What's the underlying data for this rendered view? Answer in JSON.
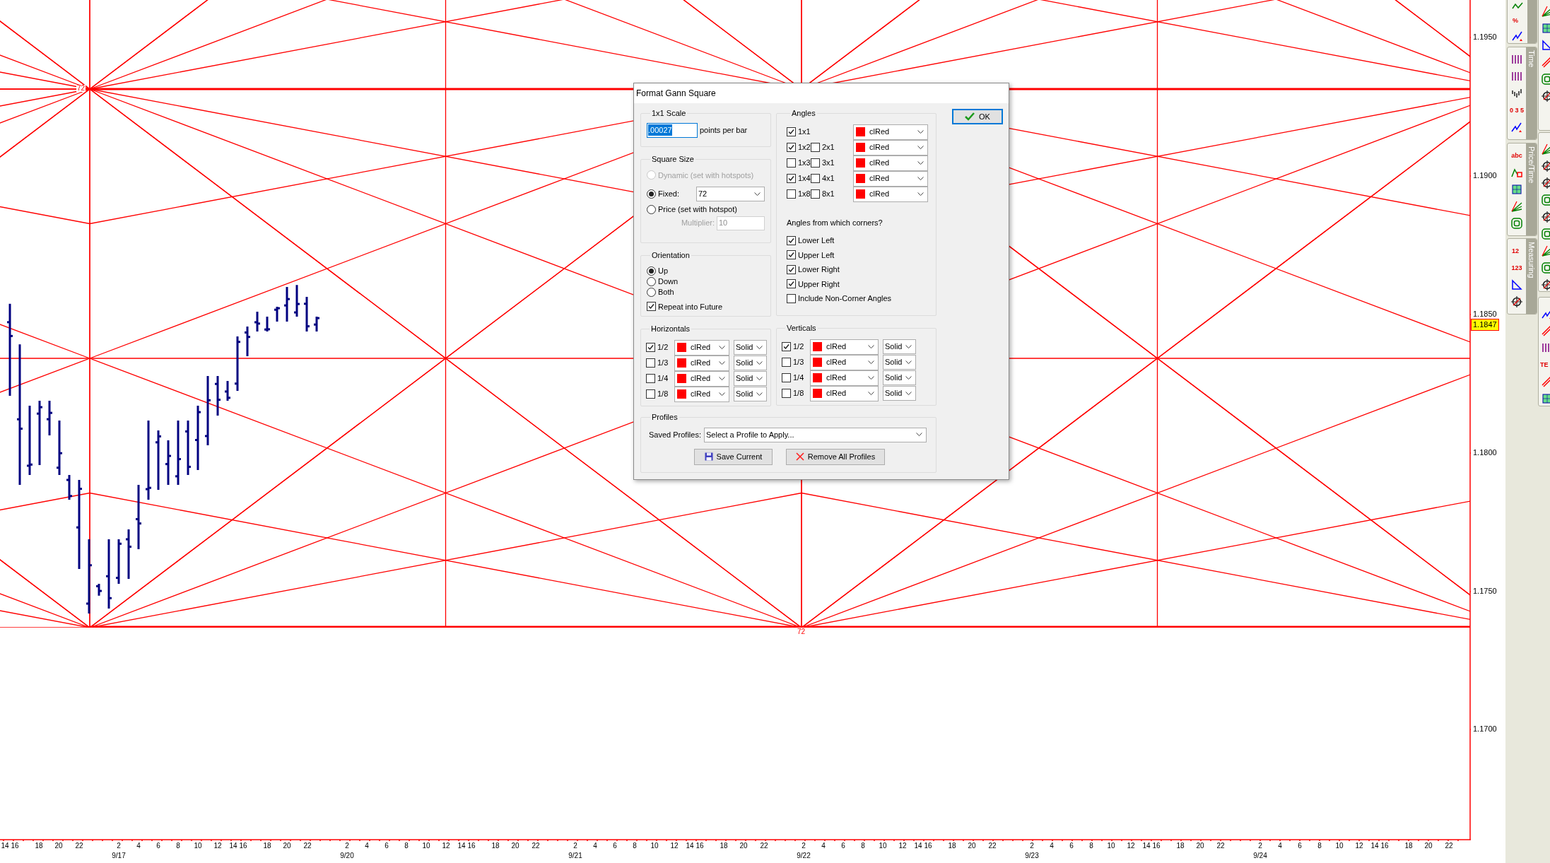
{
  "chart": {
    "price_labels": [
      "1.1950",
      "1.1900",
      "1.1850",
      "1.1800",
      "1.1750",
      "1.1700"
    ],
    "current_price": "1.1847",
    "square_labels": [
      "72",
      "72"
    ],
    "time_axis": [
      {
        "hours": [
          "14 16",
          "18",
          "20",
          "22"
        ]
      },
      {
        "date": "9/17",
        "hours": [
          "2",
          "4",
          "6",
          "8",
          "10",
          "12",
          "14 16",
          "18",
          "20",
          "22"
        ]
      },
      {
        "date": "9/20",
        "hours": [
          "2",
          "4",
          "6",
          "8",
          "10",
          "12",
          "14 16",
          "18",
          "20",
          "22"
        ]
      },
      {
        "date": "9/21",
        "hours": [
          "2",
          "4",
          "6",
          "8",
          "10",
          "12",
          "14 16",
          "18",
          "20",
          "22"
        ]
      },
      {
        "date": "9/22",
        "hours": [
          "2",
          "4",
          "6",
          "8",
          "10",
          "12",
          "14 16",
          "18",
          "20",
          "22"
        ]
      },
      {
        "date": "9/23",
        "hours": [
          "2",
          "4",
          "6",
          "8",
          "10",
          "12",
          "14 16",
          "18",
          "20",
          "22"
        ]
      },
      {
        "date": "9/24",
        "hours": [
          "2",
          "4",
          "6",
          "8",
          "10",
          "12",
          "14 16",
          "18",
          "20",
          "22"
        ]
      }
    ]
  },
  "toolbars": [
    {
      "buttons": [
        {
          "kind": "wave"
        },
        {
          "kind": "text",
          "label": "%"
        },
        {
          "kind": "trend"
        }
      ]
    },
    {
      "title": "Time",
      "buttons": [
        {
          "kind": "cycles"
        },
        {
          "kind": "cycles"
        },
        {
          "kind": "bars"
        },
        {
          "kind": "text",
          "label": "0 3 5"
        },
        {
          "kind": "trend"
        }
      ]
    },
    {
      "title": "Price/Time",
      "buttons": [
        {
          "kind": "text",
          "label": "abc"
        },
        {
          "kind": "zigzag"
        },
        {
          "kind": "grid"
        },
        {
          "kind": "fan"
        },
        {
          "kind": "spiral"
        }
      ]
    },
    {
      "title": "Measuring",
      "buttons": [
        {
          "kind": "text",
          "label": "12"
        },
        {
          "kind": "text",
          "label": "123"
        },
        {
          "kind": "triangle"
        },
        {
          "kind": "target"
        }
      ]
    }
  ],
  "side_toolbars": [
    {
      "buttons": [
        {
          "kind": "fan"
        },
        {
          "kind": "grid"
        },
        {
          "kind": "triangle"
        },
        {
          "kind": "lines"
        },
        {
          "kind": "spiral"
        },
        {
          "kind": "target"
        }
      ]
    },
    {
      "buttons": [
        {
          "kind": "fan"
        },
        {
          "kind": "target"
        },
        {
          "kind": "target"
        },
        {
          "kind": "spiral"
        },
        {
          "kind": "target"
        },
        {
          "kind": "spiral"
        },
        {
          "kind": "fan"
        },
        {
          "kind": "spiral"
        },
        {
          "kind": "target"
        }
      ]
    },
    {
      "buttons": [
        {
          "kind": "trend"
        },
        {
          "kind": "lines"
        },
        {
          "kind": "cycles"
        },
        {
          "kind": "text",
          "label": "TE"
        },
        {
          "kind": "lines"
        },
        {
          "kind": "grid"
        }
      ]
    }
  ],
  "dialog": {
    "title": "Format Gann Square",
    "scale": {
      "label": "1x1 Scale",
      "value": ".00027",
      "unit": "points per bar"
    },
    "square_size": {
      "label": "Square Size",
      "options": [
        {
          "label": "Dynamic (set with hotspots)",
          "selected": false,
          "disabled": true
        },
        {
          "label": "Fixed:",
          "selected": true,
          "disabled": false
        },
        {
          "label": "Price (set with hotspot)",
          "selected": false,
          "disabled": false
        }
      ],
      "fixed_value": "72",
      "multiplier_label": "Multiplier:",
      "multiplier_value": "10"
    },
    "orientation": {
      "label": "Orientation",
      "options": [
        {
          "label": "Up",
          "selected": true
        },
        {
          "label": "Down",
          "selected": false
        },
        {
          "label": "Both",
          "selected": false
        }
      ],
      "repeat": {
        "label": "Repeat into Future",
        "checked": true
      }
    },
    "angles": {
      "label": "Angles",
      "rows": [
        {
          "left": {
            "label": "1x1",
            "checked": true
          },
          "color_name": "clRed"
        },
        {
          "left": {
            "label": "1x2",
            "checked": true
          },
          "right": {
            "label": "2x1",
            "checked": false
          },
          "color_name": "clRed"
        },
        {
          "left": {
            "label": "1x3",
            "checked": false
          },
          "right": {
            "label": "3x1",
            "checked": false
          },
          "color_name": "clRed"
        },
        {
          "left": {
            "label": "1x4",
            "checked": true
          },
          "right": {
            "label": "4x1",
            "checked": false
          },
          "color_name": "clRed"
        },
        {
          "left": {
            "label": "1x8",
            "checked": false
          },
          "right": {
            "label": "8x1",
            "checked": false
          },
          "color_name": "clRed"
        }
      ]
    },
    "corners": {
      "label": "Angles from which corners?",
      "items": [
        {
          "label": "Lower Left",
          "checked": true
        },
        {
          "label": "Upper Left",
          "checked": true
        },
        {
          "label": "Lower Right",
          "checked": true
        },
        {
          "label": "Upper Right",
          "checked": true
        },
        {
          "label": "Include Non-Corner Angles",
          "checked": false
        }
      ]
    },
    "horizontals": {
      "label": "Horizontals",
      "rows": [
        {
          "label": "1/2",
          "checked": true,
          "color_name": "clRed",
          "style": "Solid"
        },
        {
          "label": "1/3",
          "checked": false,
          "color_name": "clRed",
          "style": "Solid"
        },
        {
          "label": "1/4",
          "checked": false,
          "color_name": "clRed",
          "style": "Solid"
        },
        {
          "label": "1/8",
          "checked": false,
          "color_name": "clRed",
          "style": "Solid"
        }
      ]
    },
    "verticals": {
      "label": "Verticals",
      "rows": [
        {
          "label": "1/2",
          "checked": true,
          "color_name": "clRed",
          "style": "Solid"
        },
        {
          "label": "1/3",
          "checked": false,
          "color_name": "clRed",
          "style": "Solid"
        },
        {
          "label": "1/4",
          "checked": false,
          "color_name": "clRed",
          "style": "Solid"
        },
        {
          "label": "1/8",
          "checked": false,
          "color_name": "clRed",
          "style": "Solid"
        }
      ]
    },
    "profiles": {
      "label": "Profiles",
      "saved_label": "Saved Profiles:",
      "value": "Select a Profile to Apply...",
      "buttons": [
        "Save Current",
        "Remove All Profiles"
      ]
    },
    "ok": "OK"
  }
}
